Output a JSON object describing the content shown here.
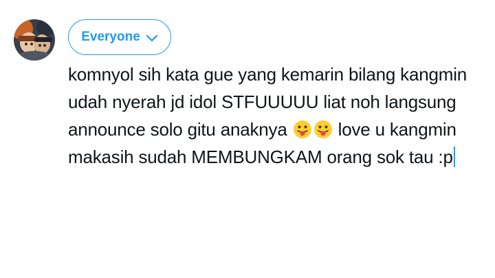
{
  "audience": {
    "label": "Everyone",
    "icon": "chevron-down-icon"
  },
  "avatar": {
    "icon": "avatar"
  },
  "compose": {
    "text_part1": "komnyol sih kata gue yang kemarin bilang kangmin udah nyerah jd idol STFUUUUU liat noh langsung announce solo gitu anaknya",
    "emoji": [
      "tongue-out-face-icon",
      "tongue-out-face-icon"
    ],
    "text_part2": "love u kangmin makasih sudah MEMBUNGKAM orang sok tau :p"
  },
  "colors": {
    "accent": "#1d9bf0",
    "text": "#0f1419",
    "background": "#ffffff"
  }
}
